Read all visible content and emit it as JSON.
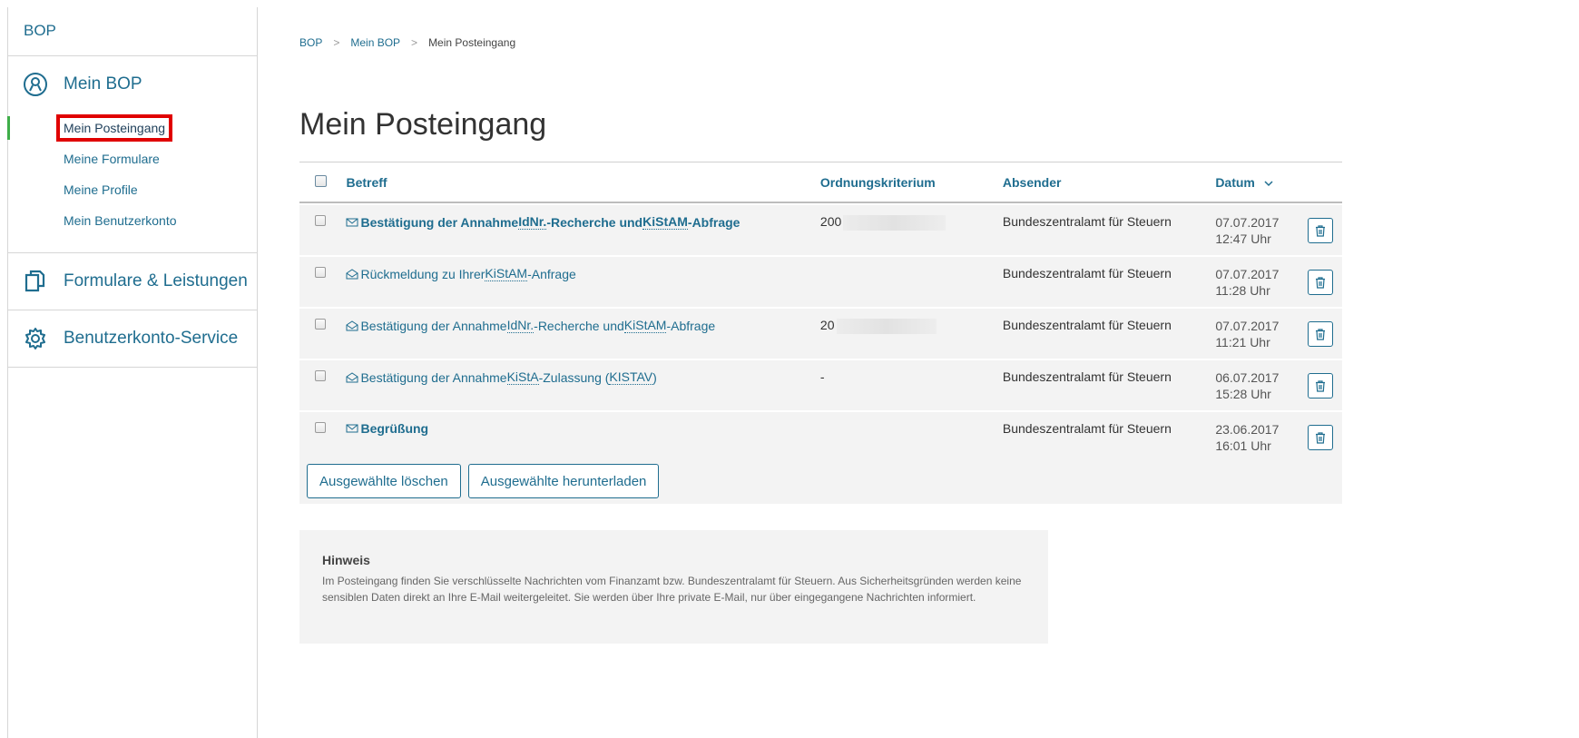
{
  "sidebar": {
    "brand": "BOP",
    "sections": [
      {
        "label": "Mein BOP",
        "icon": "user-circle-icon"
      },
      {
        "label": "Formulare & Leistungen",
        "icon": "documents-icon"
      },
      {
        "label": "Benutzerkonto-Service",
        "icon": "gear-icon"
      }
    ],
    "sub_items": [
      "Mein Posteingang",
      "Meine Formulare",
      "Meine Profile",
      "Mein Benutzerkonto"
    ]
  },
  "breadcrumb": [
    "BOP",
    "Mein BOP",
    "Mein Posteingang"
  ],
  "page_title": "Mein Posteingang",
  "table": {
    "headers": {
      "subject": "Betreff",
      "order": "Ordnungskriterium",
      "sender": "Absender",
      "date": "Datum"
    },
    "rows": [
      {
        "subject_pre": "Bestätigung der Annahme ",
        "abbr1": "IdNr.",
        "subject_mid": "-Recherche und ",
        "abbr2": "KiStAM",
        "subject_post": "-Abfrage",
        "order": "200",
        "sender": "Bundeszentralamt für Steuern",
        "date": "07.07.2017",
        "time": "12:47 Uhr",
        "unread": true
      },
      {
        "subject_pre": "Rückmeldung zu Ihrer ",
        "abbr1": "KiStAM",
        "subject_mid": "-Anfrage",
        "abbr2": "",
        "subject_post": "",
        "order": "",
        "sender": "Bundeszentralamt für Steuern",
        "date": "07.07.2017",
        "time": "11:28 Uhr",
        "unread": false
      },
      {
        "subject_pre": "Bestätigung der Annahme ",
        "abbr1": "IdNr.",
        "subject_mid": "-Recherche und ",
        "abbr2": "KiStAM",
        "subject_post": "-Abfrage",
        "order": "20",
        "sender": "Bundeszentralamt für Steuern",
        "date": "07.07.2017",
        "time": "11:21 Uhr",
        "unread": false
      },
      {
        "subject_pre": "Bestätigung der Annahme ",
        "abbr1": "KiStA",
        "subject_mid": "-Zulassung (",
        "abbr2": "KISTAV",
        "subject_post": ")",
        "order": "-",
        "sender": "Bundeszentralamt für Steuern",
        "date": "06.07.2017",
        "time": "15:28 Uhr",
        "unread": false
      },
      {
        "subject_pre": "Begrüßung",
        "abbr1": "",
        "subject_mid": "",
        "abbr2": "",
        "subject_post": "",
        "order": "",
        "sender": "Bundeszentralamt für Steuern",
        "date": "23.06.2017",
        "time": "16:01 Uhr",
        "unread": true
      }
    ]
  },
  "buttons": {
    "delete_selected": "Ausgewählte löschen",
    "download_selected": "Ausgewählte herunterladen"
  },
  "hint": {
    "title": "Hinweis",
    "text": "Im Posteingang finden Sie verschlüsselte Nachrichten vom Finanzamt bzw. Bundeszentralamt für Steuern. Aus Sicherheitsgründen werden keine sensiblen Daten direkt an Ihre E-Mail weitergeleitet. Sie werden über Ihre private E-Mail, nur über eingegangene Nachrichten informiert."
  },
  "colors": {
    "link": "#1f6d8f",
    "active_bar": "#3fae49",
    "highlight": "#e00000"
  }
}
